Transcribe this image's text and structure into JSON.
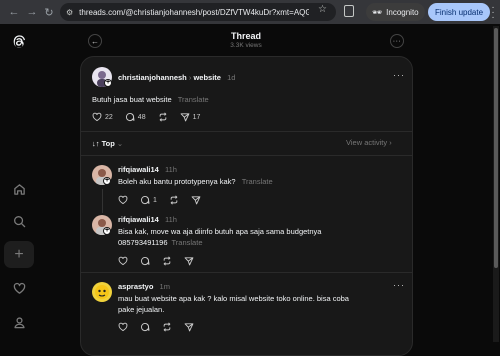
{
  "browser": {
    "url": "threads.com/@christianjohannesh/post/DZfVTW4kuDr?xmt=AQG...",
    "incognito_label": "Incognito",
    "finish_update_label": "Finish update"
  },
  "header": {
    "title": "Thread",
    "views": "3.3K views"
  },
  "post": {
    "username": "christianjohannesh",
    "topic": "website",
    "time": "1d",
    "text": "Butuh jasa buat website",
    "translate": "Translate",
    "likes": "22",
    "replies": "48",
    "reposts": "",
    "shares": "17"
  },
  "sort": {
    "label": "Top",
    "view_activity": "View activity"
  },
  "replies": [
    {
      "username": "rifqiawali14",
      "time": "11h",
      "lines": [
        "Boleh aku bantu prototypenya kak?"
      ],
      "translate": "Translate",
      "replies": "1"
    },
    {
      "username": "rifqiawali14",
      "time": "11h",
      "lines": [
        "Bisa kak, move wa aja diinfo butuh apa saja sama budgetnya",
        "085793491196"
      ],
      "translate": "Translate"
    },
    {
      "username": "asprastyo",
      "time": "1m",
      "lines": [
        "mau buat website apa kak ? kalo misal website toko online. bisa coba",
        "pake jejualan."
      ]
    }
  ],
  "colors": {
    "bg": "#0a0a0a",
    "panel": "#181818",
    "finish_button": "#a8c7fa"
  }
}
